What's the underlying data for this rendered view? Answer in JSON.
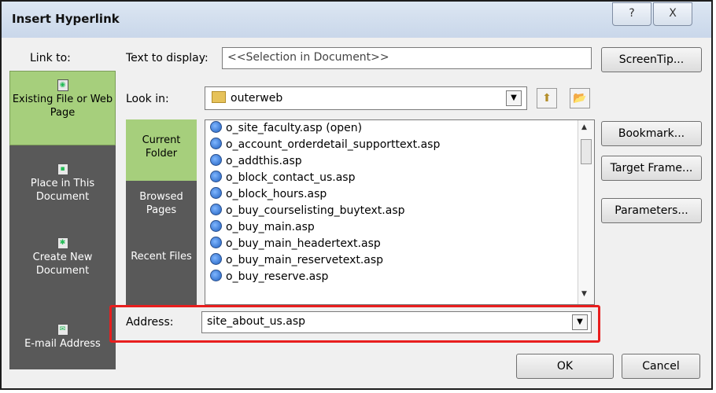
{
  "window": {
    "title": "Insert Hyperlink",
    "help_glyph": "?",
    "close_glyph": "X"
  },
  "link_to": {
    "label": "Link to:",
    "items": [
      {
        "label": "Existing File or Web Page",
        "icon": "existing-file-icon",
        "selected": true
      },
      {
        "label": "Place in This Document",
        "icon": "place-in-document-icon",
        "selected": false
      },
      {
        "label": "Create New Document",
        "icon": "new-document-icon",
        "selected": false
      },
      {
        "label": "E-mail Address",
        "icon": "email-icon",
        "selected": false
      }
    ]
  },
  "text_to_display": {
    "label": "Text to display:",
    "value": "<<Selection in Document>>"
  },
  "look_in": {
    "label": "Look in:",
    "value": "outerweb",
    "folder_icon": "folder-icon",
    "up_folder_icon": "up-folder-icon",
    "browse_icon": "open-folder-icon"
  },
  "nav": {
    "items": [
      {
        "label": "Current Folder",
        "selected": true
      },
      {
        "label": "Browsed Pages",
        "selected": false
      },
      {
        "label": "Recent Files",
        "selected": false
      }
    ]
  },
  "files": [
    "o_site_faculty.asp (open)",
    "o_account_orderdetail_supporttext.asp",
    "o_addthis.asp",
    "o_block_contact_us.asp",
    "o_block_hours.asp",
    "o_buy_courselisting_buytext.asp",
    "o_buy_main.asp",
    "o_buy_main_headertext.asp",
    "o_buy_main_reservetext.asp",
    "o_buy_reserve.asp"
  ],
  "address": {
    "label": "Address:",
    "value": "site_about_us.asp"
  },
  "buttons": {
    "screentip": "ScreenTip...",
    "bookmark": "Bookmark...",
    "target_frame": "Target Frame...",
    "parameters": "Parameters...",
    "ok": "OK",
    "cancel": "Cancel"
  },
  "colors": {
    "selected_green": "#a6cf7c",
    "bar_gray": "#595959",
    "highlight_red": "#e81e1e"
  }
}
